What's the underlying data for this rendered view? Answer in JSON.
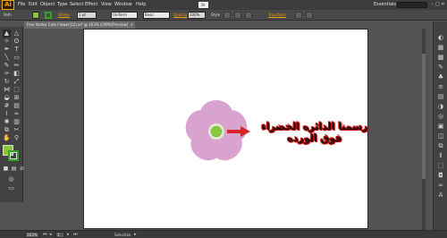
{
  "app": {
    "logo": "Ai"
  },
  "menu": {
    "items": [
      "File",
      "Edit",
      "Object",
      "Type",
      "Select",
      "Effect",
      "View",
      "Window",
      "Help"
    ]
  },
  "bridge_button": "Br",
  "workspace": {
    "label": "Essentials ▾"
  },
  "window_controls": {
    "minimize": "–",
    "maximize": "□",
    "close": "✕"
  },
  "control_bar": {
    "selection_label": "Path",
    "fill_color": "#8cc63f",
    "stroke_color": "#33a02c",
    "stroke_link": "Stroke",
    "stroke_weight": "1 pt",
    "profile": "Uniform",
    "brush": "Basic",
    "opacity_link": "Opacity",
    "opacity_value": "100%",
    "style_label": "Style",
    "transform_link": "Transform"
  },
  "document": {
    "tab_title": "Free Vector Cute Flower(12).ai* @ 163% (CMYK/Preview)",
    "tab_close": "×"
  },
  "annotation": {
    "line1": "رسمنا الدائره الخضراء",
    "line2": "فوق الورده"
  },
  "flower": {
    "petal_color": "#d9a3cf",
    "center_outer_color": "#e8f0d8",
    "center_inner_color": "#8cc63f",
    "arrow_color": "#d9232d"
  },
  "tools": [
    {
      "icon": "selection-tool-icon",
      "glyph": "▲"
    },
    {
      "icon": "direct-selection-tool-icon",
      "glyph": "△"
    },
    {
      "icon": "magic-wand-tool-icon",
      "glyph": "✧"
    },
    {
      "icon": "lasso-tool-icon",
      "glyph": "ʘ"
    },
    {
      "icon": "pen-tool-icon",
      "glyph": "✒"
    },
    {
      "icon": "type-tool-icon",
      "glyph": "T"
    },
    {
      "icon": "line-tool-icon",
      "glyph": "╲"
    },
    {
      "icon": "rectangle-tool-icon",
      "glyph": "▭"
    },
    {
      "icon": "paintbrush-tool-icon",
      "glyph": "✎"
    },
    {
      "icon": "pencil-tool-icon",
      "glyph": "✏"
    },
    {
      "icon": "blob-brush-tool-icon",
      "glyph": "✑"
    },
    {
      "icon": "eraser-tool-icon",
      "glyph": "◧"
    },
    {
      "icon": "rotate-tool-icon",
      "glyph": "↻"
    },
    {
      "icon": "scale-tool-icon",
      "glyph": "⤢"
    },
    {
      "icon": "width-tool-icon",
      "glyph": "⋈"
    },
    {
      "icon": "free-transform-tool-icon",
      "glyph": "⬚"
    },
    {
      "icon": "shape-builder-tool-icon",
      "glyph": "◒"
    },
    {
      "icon": "perspective-grid-tool-icon",
      "glyph": "⊞"
    },
    {
      "icon": "mesh-tool-icon",
      "glyph": "#"
    },
    {
      "icon": "gradient-tool-icon",
      "glyph": "▤"
    },
    {
      "icon": "eyedropper-tool-icon",
      "glyph": "⌇"
    },
    {
      "icon": "blend-tool-icon",
      "glyph": "∞"
    },
    {
      "icon": "symbol-sprayer-tool-icon",
      "glyph": "✺"
    },
    {
      "icon": "column-graph-tool-icon",
      "glyph": "▥"
    },
    {
      "icon": "artboard-tool-icon",
      "glyph": "⧉"
    },
    {
      "icon": "slice-tool-icon",
      "glyph": "✂"
    },
    {
      "icon": "hand-tool-icon",
      "glyph": "✋"
    },
    {
      "icon": "zoom-tool-icon",
      "glyph": "⚲"
    }
  ],
  "dock_icons": [
    {
      "icon": "color-panel-icon",
      "glyph": "◐"
    },
    {
      "icon": "color-guide-panel-icon",
      "glyph": "▦"
    },
    {
      "icon": "swatches-panel-icon",
      "glyph": "▩"
    },
    {
      "icon": "brushes-panel-icon",
      "glyph": "✎"
    },
    {
      "icon": "symbols-panel-icon",
      "glyph": "♣"
    },
    {
      "icon": "stroke-panel-icon",
      "glyph": "≡"
    },
    {
      "icon": "gradient-panel-icon",
      "glyph": "▤"
    },
    {
      "icon": "transparency-panel-icon",
      "glyph": "◑"
    },
    {
      "icon": "appearance-panel-icon",
      "glyph": "◎"
    },
    {
      "icon": "graphic-styles-panel-icon",
      "glyph": "▣"
    },
    {
      "icon": "layers-panel-icon",
      "glyph": "◫"
    },
    {
      "icon": "artboards-panel-icon",
      "glyph": "⧉"
    },
    {
      "icon": "align-panel-icon",
      "glyph": "⫴"
    },
    {
      "icon": "transform-panel-icon",
      "glyph": "⬚"
    },
    {
      "icon": "pathfinder-panel-icon",
      "glyph": "◘"
    },
    {
      "icon": "links-panel-icon",
      "glyph": "∞"
    },
    {
      "icon": "type-panel-icon",
      "glyph": "A"
    }
  ],
  "status_bar": {
    "zoom": "163%",
    "artboard_number": "1",
    "status_label": "Selection",
    "status_arrow": "▸"
  }
}
